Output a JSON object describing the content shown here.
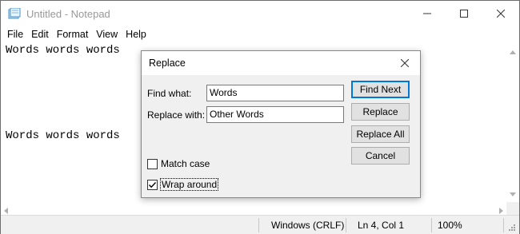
{
  "window": {
    "title": "Untitled - Notepad",
    "icon": "notepad-icon"
  },
  "menu": [
    "File",
    "Edit",
    "Format",
    "View",
    "Help"
  ],
  "editor": {
    "lines": [
      "Words words words",
      "",
      "",
      "Words words words"
    ]
  },
  "status": {
    "encoding": "Windows (CRLF)",
    "position": "Ln 4, Col 1",
    "zoom": "100%"
  },
  "dialog": {
    "title": "Replace",
    "find_label": "Find what:",
    "find_value": "Words",
    "replace_label": "Replace with:",
    "replace_value": "Other Words",
    "buttons": {
      "find_next": "Find Next",
      "replace": "Replace",
      "replace_all": "Replace All",
      "cancel": "Cancel"
    },
    "match_case": {
      "label": "Match case",
      "checked": false
    },
    "wrap_around": {
      "label": "Wrap around",
      "checked": true
    }
  }
}
